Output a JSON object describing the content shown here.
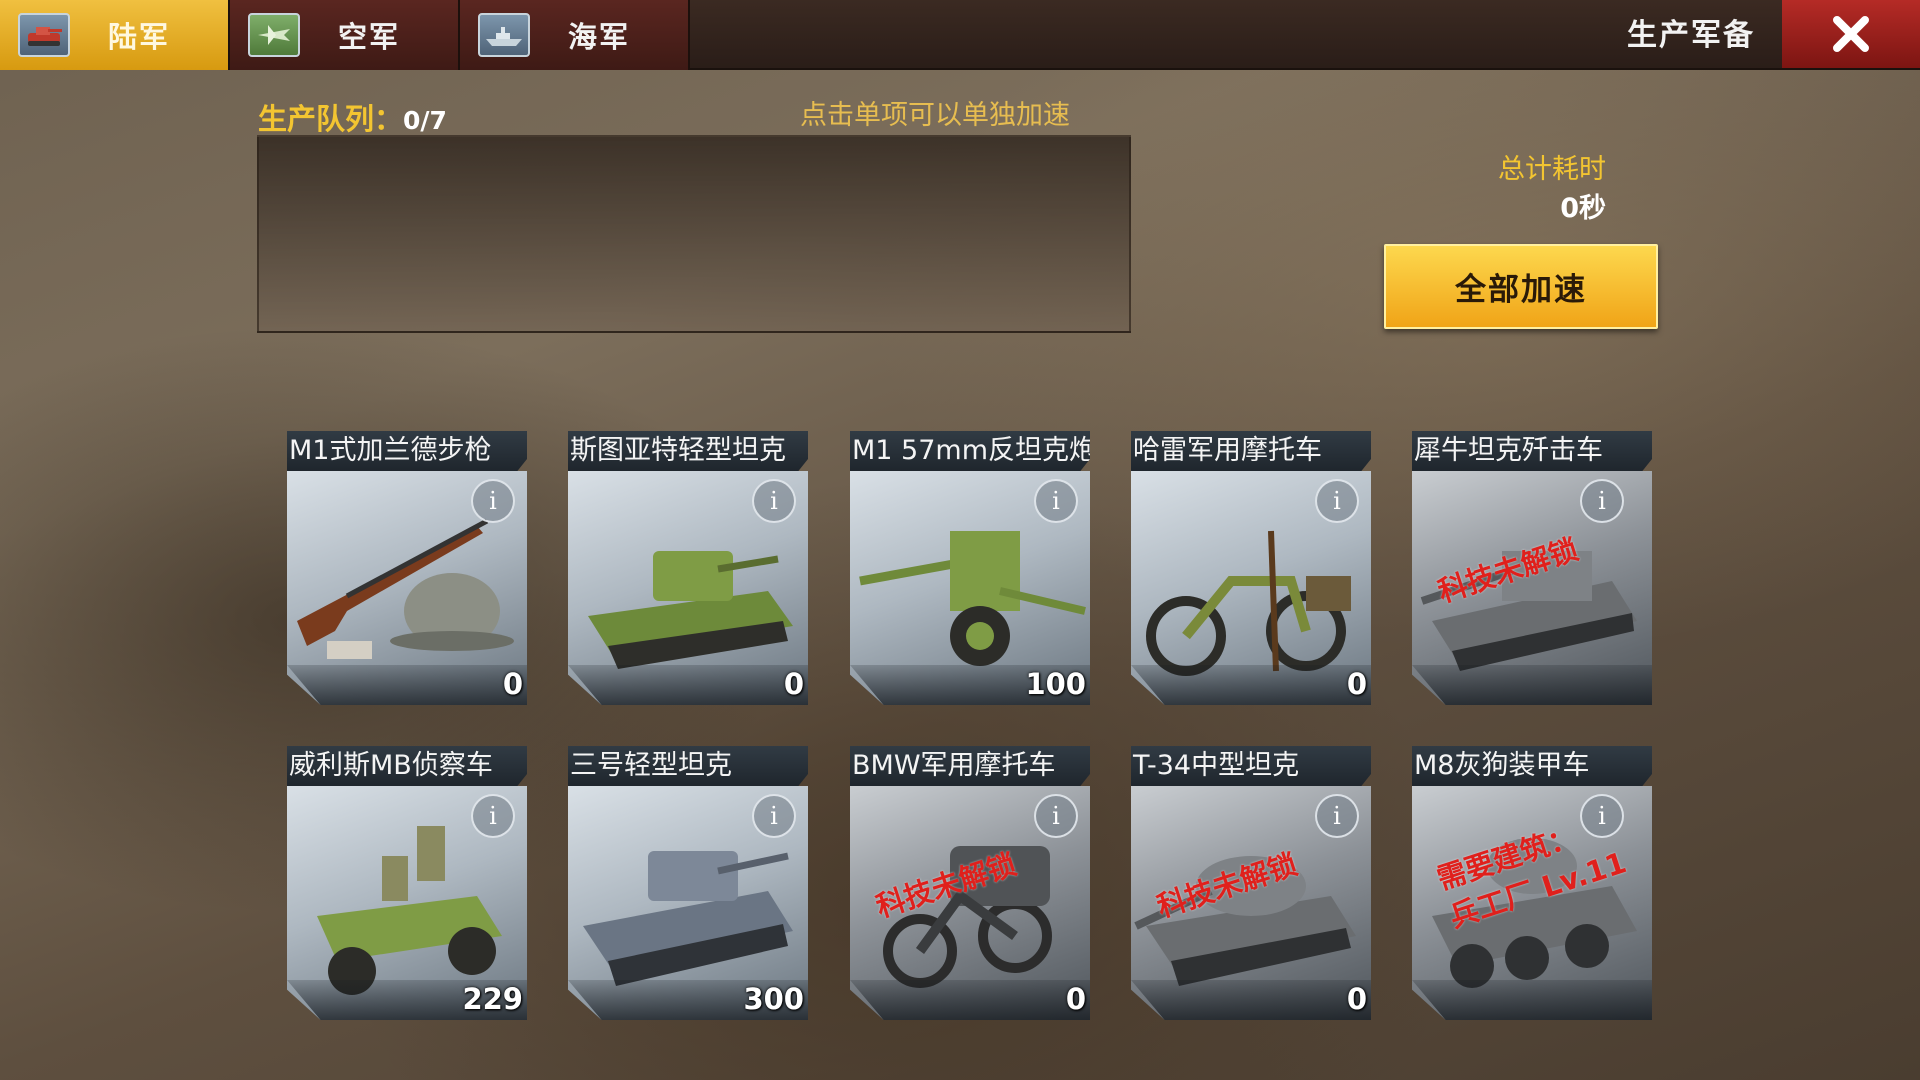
{
  "tabs": [
    {
      "label": "陆军",
      "icon": "tank-icon",
      "active": true
    },
    {
      "label": "空军",
      "icon": "plane-icon",
      "active": false
    },
    {
      "label": "海军",
      "icon": "ship-icon",
      "active": false
    }
  ],
  "header": {
    "title": "生产军备",
    "close_icon": "close-icon"
  },
  "queue": {
    "label": "生产队列：",
    "count": "0/7",
    "hint": "点击单项可以单独加速"
  },
  "total": {
    "label": "总计耗时",
    "value": "0秒",
    "speedup_label": "全部加速"
  },
  "units": [
    {
      "name": "M1式加兰德步枪",
      "qty": "0",
      "lock": "",
      "icon": "rifle-helmet-icon"
    },
    {
      "name": "斯图亚特轻型坦克",
      "qty": "0",
      "lock": "",
      "icon": "light-tank-icon"
    },
    {
      "name": "M1 57mm反坦克炮",
      "qty": "100",
      "lock": "",
      "icon": "anti-tank-gun-icon"
    },
    {
      "name": "哈雷军用摩托车",
      "qty": "0",
      "lock": "",
      "icon": "motorcycle-icon"
    },
    {
      "name": "犀牛坦克歼击车",
      "qty": "",
      "lock": "科技未解锁",
      "icon": "tank-destroyer-icon"
    },
    {
      "name": "威利斯MB侦察车",
      "qty": "229",
      "lock": "",
      "icon": "jeep-icon"
    },
    {
      "name": "三号轻型坦克",
      "qty": "300",
      "lock": "",
      "icon": "panzer-tank-icon"
    },
    {
      "name": "BMW军用摩托车",
      "qty": "0",
      "lock": "科技未解锁",
      "icon": "sidecar-motorcycle-icon"
    },
    {
      "name": "T-34中型坦克",
      "qty": "0",
      "lock": "科技未解锁",
      "icon": "medium-tank-icon"
    },
    {
      "name": "M8灰狗装甲车",
      "qty": "",
      "lock": "需要建筑：\n兵工厂 Lv.11",
      "icon": "armored-car-icon"
    }
  ],
  "colors": {
    "accent": "#f3c531",
    "close": "#b52b26",
    "locked_text": "#e0201c"
  }
}
